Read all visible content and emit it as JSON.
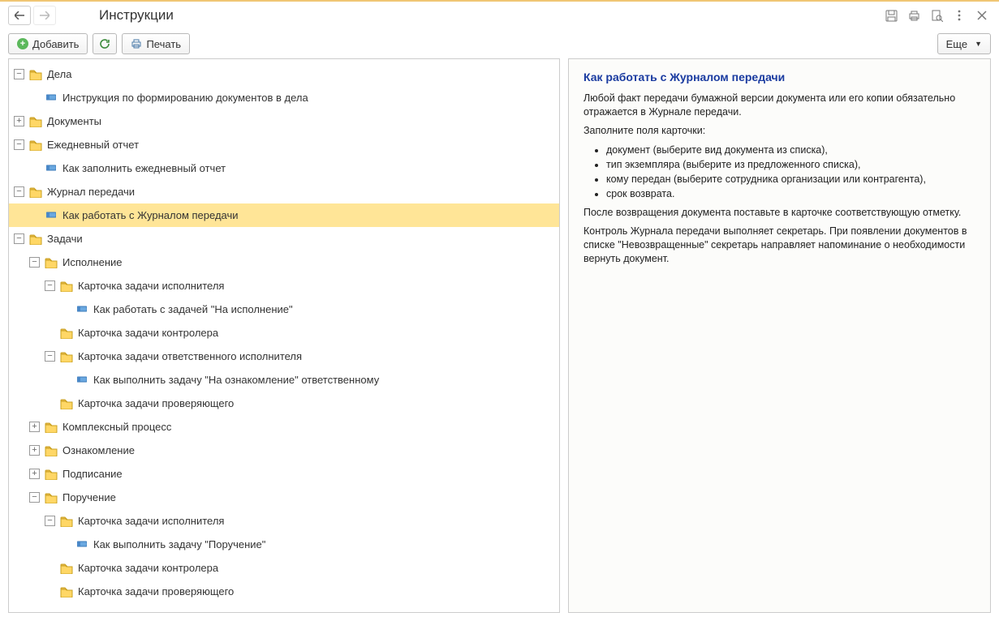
{
  "header": {
    "title": "Инструкции"
  },
  "toolbar": {
    "add": "Добавить",
    "print": "Печать",
    "more": "Еще"
  },
  "tree": [
    {
      "depth": 0,
      "kind": "folder",
      "toggle": "minus",
      "label": "Дела"
    },
    {
      "depth": 1,
      "kind": "doc",
      "label": "Инструкция по формированию документов в дела"
    },
    {
      "depth": 0,
      "kind": "folder",
      "toggle": "plus",
      "label": "Документы"
    },
    {
      "depth": 0,
      "kind": "folder",
      "toggle": "minus",
      "label": "Ежедневный отчет"
    },
    {
      "depth": 1,
      "kind": "doc",
      "label": "Как заполнить ежедневный отчет"
    },
    {
      "depth": 0,
      "kind": "folder",
      "toggle": "minus",
      "label": "Журнал передачи"
    },
    {
      "depth": 1,
      "kind": "doc",
      "label": "Как работать с Журналом передачи",
      "selected": true
    },
    {
      "depth": 0,
      "kind": "folder",
      "toggle": "minus",
      "label": "Задачи"
    },
    {
      "depth": 1,
      "kind": "folder",
      "toggle": "minus",
      "label": "Исполнение"
    },
    {
      "depth": 2,
      "kind": "folder",
      "toggle": "minus",
      "label": "Карточка задачи исполнителя"
    },
    {
      "depth": 3,
      "kind": "doc",
      "label": "Как работать с задачей \"На исполнение\""
    },
    {
      "depth": 2,
      "kind": "folder",
      "toggle": "none",
      "label": "Карточка задачи контролера"
    },
    {
      "depth": 2,
      "kind": "folder",
      "toggle": "minus",
      "label": "Карточка задачи ответственного исполнителя"
    },
    {
      "depth": 3,
      "kind": "doc",
      "label": "Как выполнить задачу \"На ознакомление\" ответственному"
    },
    {
      "depth": 2,
      "kind": "folder",
      "toggle": "none",
      "label": "Карточка задачи проверяющего"
    },
    {
      "depth": 1,
      "kind": "folder",
      "toggle": "plus",
      "label": "Комплексный процесс"
    },
    {
      "depth": 1,
      "kind": "folder",
      "toggle": "plus",
      "label": "Ознакомление"
    },
    {
      "depth": 1,
      "kind": "folder",
      "toggle": "plus",
      "label": "Подписание"
    },
    {
      "depth": 1,
      "kind": "folder",
      "toggle": "minus",
      "label": "Поручение"
    },
    {
      "depth": 2,
      "kind": "folder",
      "toggle": "minus",
      "label": "Карточка задачи исполнителя"
    },
    {
      "depth": 3,
      "kind": "doc",
      "label": "Как выполнить задачу \"Поручение\""
    },
    {
      "depth": 2,
      "kind": "folder",
      "toggle": "none",
      "label": "Карточка задачи контролера"
    },
    {
      "depth": 2,
      "kind": "folder",
      "toggle": "none",
      "label": "Карточка задачи проверяющего"
    }
  ],
  "detail": {
    "title": "Как работать с Журналом передачи",
    "p1": "Любой факт передачи бумажной версии документа или его копии обязательно отражается в Журнале передачи.",
    "p2": "Заполните поля карточки:",
    "bullets": [
      "документ (выберите вид документа из списка),",
      "тип экземпляра (выберите из предложенного списка),",
      "кому передан (выберите сотрудника организации или контрагента),",
      "срок возврата."
    ],
    "p3": "После возвращения документа поставьте в карточке соответствующую отметку.",
    "p4": "Контроль Журнала передачи выполняет секретарь. При появлении документов в списке \"Невозвращенные\" секретарь направляет напоминание о необходимости вернуть документ."
  }
}
